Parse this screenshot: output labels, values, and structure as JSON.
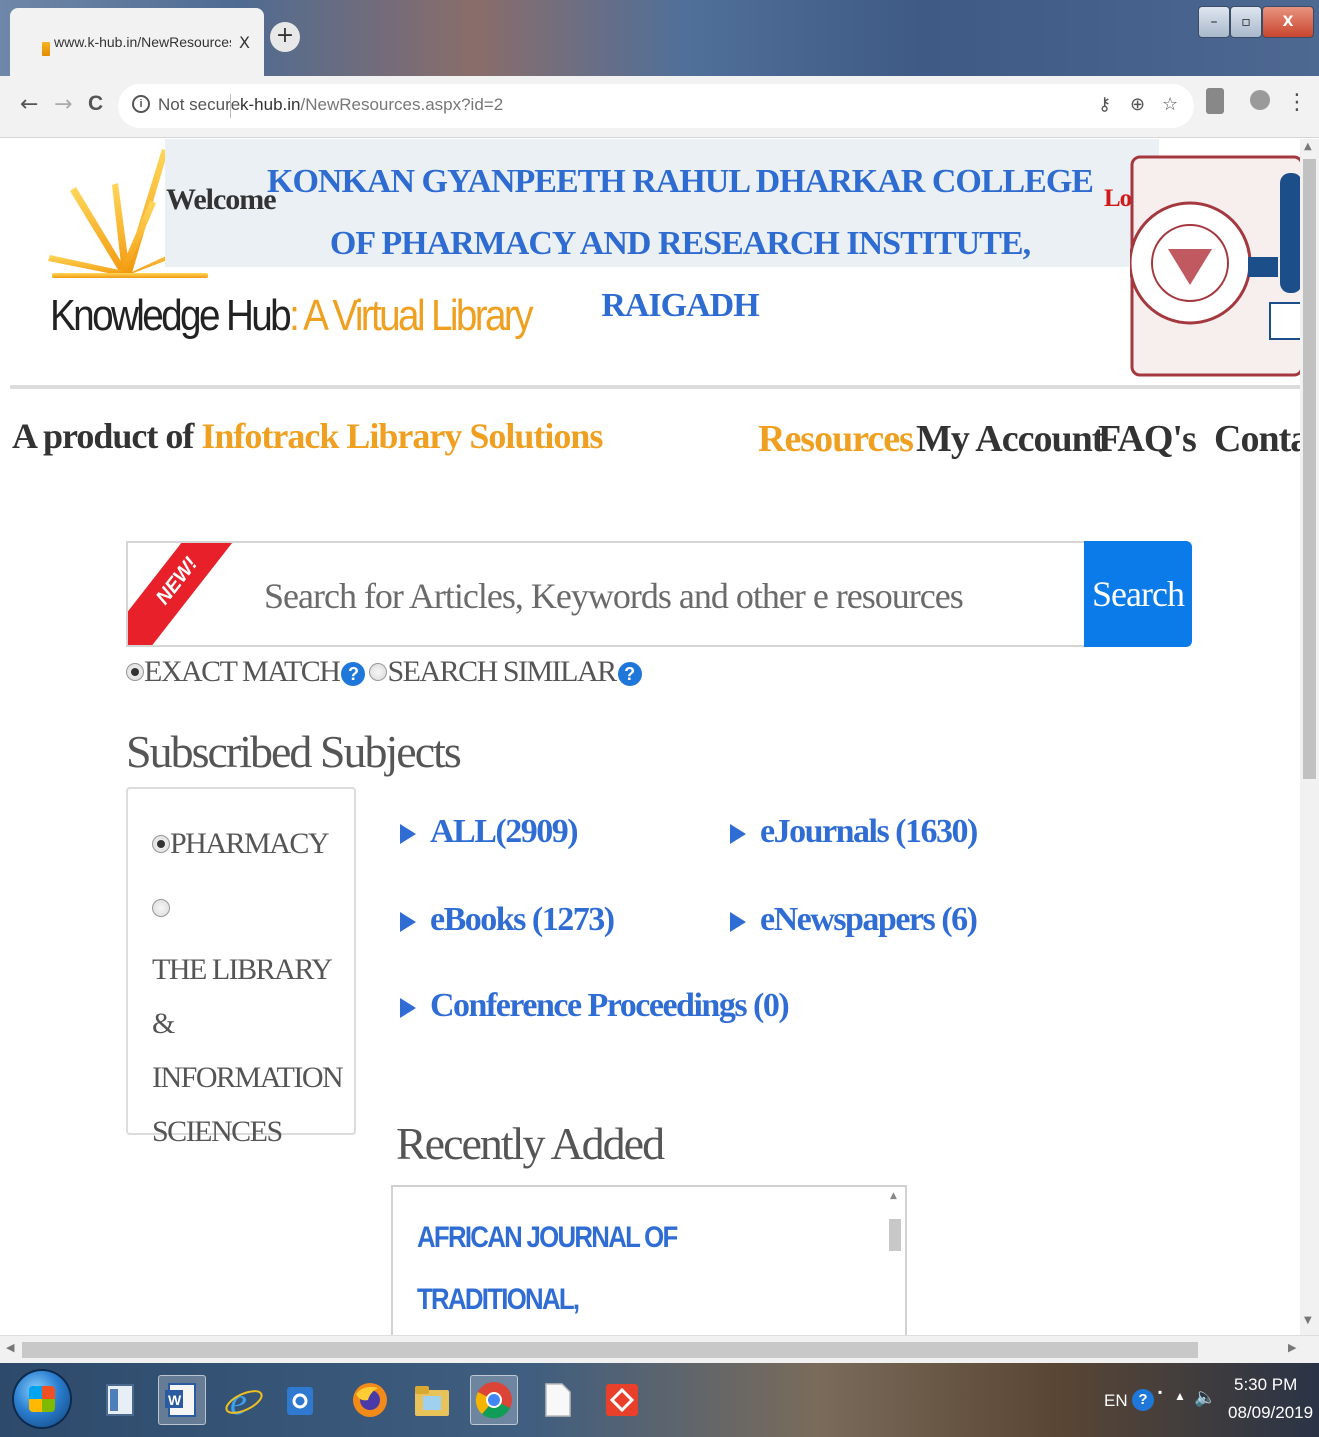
{
  "browser": {
    "tab_title": "www.k-hub.in/NewResources.aspx?id=2",
    "tab_close": "X",
    "new_tab": "+",
    "window_controls": {
      "minimize": "–",
      "maximize": "▫",
      "close": "X"
    },
    "nav": {
      "back": "←",
      "forward": "→",
      "reload": "C"
    },
    "address": {
      "security_label": "Not secure",
      "domain": "k-hub.in",
      "path": "/NewResources.aspx?id=2"
    },
    "icons": [
      "key-icon",
      "zoom-icon",
      "bookmark-star-icon",
      "extension-icon",
      "profile-icon",
      "menu-kebab-icon"
    ]
  },
  "header": {
    "welcome": "Welcome",
    "college_name": "KONKAN GYANPEETH RAHUL DHARKAR COLLEGE OF PHARMACY AND RESEARCH INSTITUTE, RAIGADH",
    "logout": "Logout",
    "site_name": "Knowledge Hub",
    "site_sep": ":",
    "site_tagline": "A Virtual Library",
    "product_prefix": "A product of",
    "product_brand": "Infotrack Library Solutions"
  },
  "nav": {
    "items": [
      {
        "label": "Resources",
        "active": true
      },
      {
        "label": "My Account",
        "active": false
      },
      {
        "label": "FAQ's",
        "active": false
      },
      {
        "label": "Contact",
        "active": false
      }
    ]
  },
  "search": {
    "badge": "NEW!",
    "placeholder": "Search for Articles, Keywords and other e resources",
    "button": "Search",
    "options": [
      {
        "label": "EXACT MATCH",
        "selected": true
      },
      {
        "label": "SEARCH SIMILAR",
        "selected": false
      }
    ],
    "help_glyph": "?"
  },
  "subjects": {
    "heading": "Subscribed Subjects",
    "items": [
      {
        "label": "PHARMACY",
        "selected": true
      },
      {
        "label": "THE LIBRARY & INFORMATION SCIENCES",
        "selected": false
      }
    ]
  },
  "resources": {
    "links": [
      {
        "label": "ALL(2909)"
      },
      {
        "label": "eJournals (1630)"
      },
      {
        "label": "eBooks (1273)"
      },
      {
        "label": "eNewspapers (6)"
      },
      {
        "label": "Conference Proceedings (0)"
      }
    ]
  },
  "recent": {
    "heading": "Recently Added",
    "items": [
      {
        "title": "AFRICAN JOURNAL OF TRADITIONAL, COMPLEMENTARY AND ALTERNATIVE"
      }
    ]
  },
  "taskbar": {
    "language": "EN",
    "time": "5:30 PM",
    "date": "08/09/2019"
  },
  "colors": {
    "accent_orange": "#f0a020",
    "link_blue": "#2f6dd5",
    "button_blue": "#0a7be8",
    "logout_red": "#d11a1a",
    "new_badge_red": "#e8202a"
  }
}
